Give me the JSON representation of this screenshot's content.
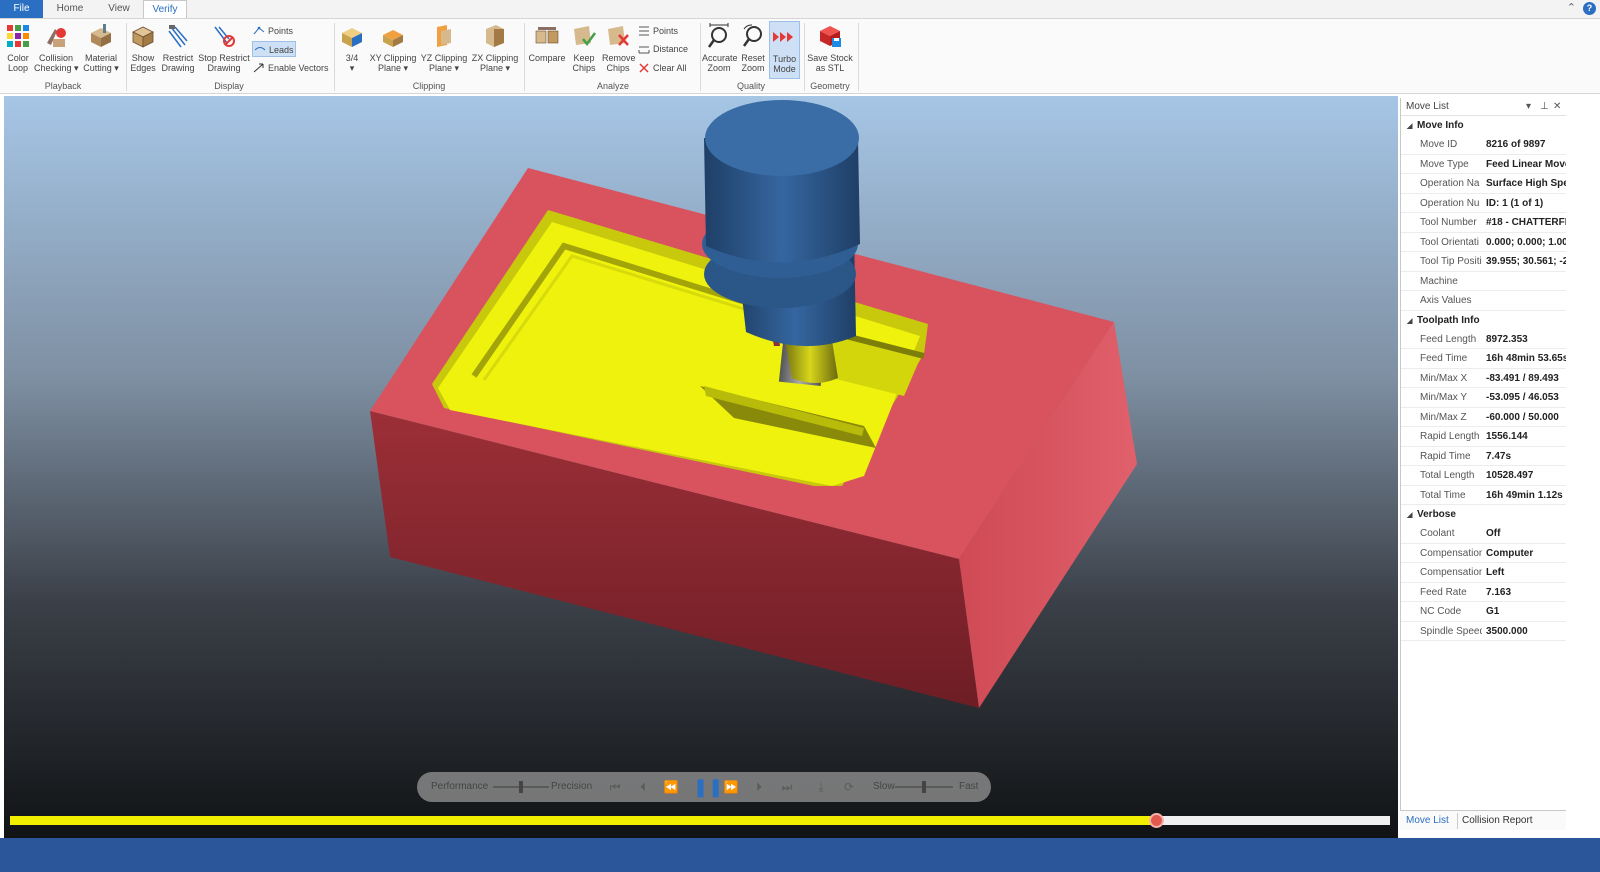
{
  "tabs": {
    "file": "File",
    "home": "Home",
    "view": "View",
    "verify": "Verify"
  },
  "ribbon": {
    "playback": {
      "label": "Playback",
      "color_loop": "Color\nLoop",
      "collision": "Collision\nChecking ▾",
      "material": "Material\nCutting ▾"
    },
    "display": {
      "label": "Display",
      "show_edges": "Show\nEdges",
      "restrict": "Restrict\nDrawing",
      "stop_restrict": "Stop Restrict\nDrawing",
      "points": "Points",
      "leads": "Leads",
      "vectors": "Enable Vectors"
    },
    "clipping": {
      "label": "Clipping",
      "three_quarter": "3/4\n▾",
      "xy": "XY Clipping\nPlane ▾",
      "yz": "YZ Clipping\nPlane ▾",
      "zx": "ZX Clipping\nPlane ▾"
    },
    "analyze": {
      "label": "Analyze",
      "compare": "Compare",
      "keep": "Keep\nChips",
      "remove": "Remove\nChips",
      "points": "Points",
      "distance": "Distance",
      "clear": "Clear All"
    },
    "quality": {
      "label": "Quality",
      "accurate": "Accurate\nZoom",
      "reset": "Reset\nZoom",
      "turbo": "Turbo\nMode"
    },
    "geometry": {
      "label": "Geometry",
      "save": "Save Stock\nas STL"
    }
  },
  "playbar": {
    "performance": "Performance",
    "precision": "Precision",
    "slow": "Slow",
    "fast": "Fast",
    "performance_precision_level": 0.5,
    "speed_level": 0.5
  },
  "progress": {
    "fraction": 0.8305
  },
  "panel": {
    "title": "Move List",
    "move_info": {
      "title": "Move Info",
      "rows": [
        {
          "k": "Move ID",
          "v": "8216 of 9897"
        },
        {
          "k": "Move Type",
          "v": "Feed Linear Move"
        },
        {
          "k": "Operation Na",
          "v": "Surface High Spe"
        },
        {
          "k": "Operation Nu",
          "v": "ID: 1 (1 of 1)"
        },
        {
          "k": "Tool Number",
          "v": "#18 - CHATTERFR"
        },
        {
          "k": "Tool Orientati",
          "v": "0.000; 0.000; 1.00"
        },
        {
          "k": "Tool Tip Positi",
          "v": "39.955; 30.561; -2"
        },
        {
          "k": "Machine",
          "v": ""
        },
        {
          "k": "Axis Values",
          "v": ""
        }
      ]
    },
    "toolpath_info": {
      "title": "Toolpath Info",
      "rows": [
        {
          "k": "Feed Length",
          "v": "8972.353"
        },
        {
          "k": "Feed Time",
          "v": "16h 48min 53.65s"
        },
        {
          "k": "Min/Max X",
          "v": "-83.491 / 89.493"
        },
        {
          "k": "Min/Max Y",
          "v": "-53.095 / 46.053"
        },
        {
          "k": "Min/Max Z",
          "v": "-60.000 / 50.000"
        },
        {
          "k": "Rapid Length",
          "v": "1556.144"
        },
        {
          "k": "Rapid Time",
          "v": "7.47s"
        },
        {
          "k": "Total Length",
          "v": "10528.497"
        },
        {
          "k": "Total Time",
          "v": "16h 49min 1.12s"
        }
      ]
    },
    "verbose": {
      "title": "Verbose",
      "rows": [
        {
          "k": "Coolant",
          "v": "Off"
        },
        {
          "k": "Compensation",
          "v": "Computer"
        },
        {
          "k": "Compensation",
          "v": "Left"
        },
        {
          "k": "Feed Rate",
          "v": "7.163"
        },
        {
          "k": "NC Code",
          "v": "G1"
        },
        {
          "k": "Spindle Speed",
          "v": "3500.000"
        }
      ]
    },
    "tab_move_list": "Move List",
    "tab_collision": "Collision Report"
  },
  "colors": {
    "accent": "#2b6fc2",
    "stock": "#d9535f",
    "cut": "#eef20c",
    "tool": "#2f5a8a",
    "progress": "#f2ef00"
  }
}
